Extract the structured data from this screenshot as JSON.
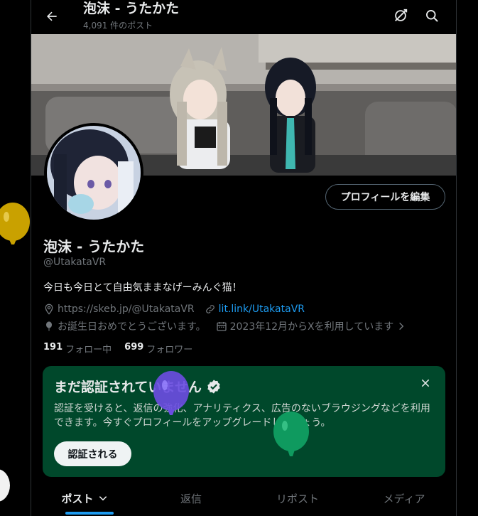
{
  "header": {
    "title": "泡沫 - うたかた",
    "post_count": "4,091 件のポスト"
  },
  "profile": {
    "name": "泡沫 - うたかた",
    "handle": "@UtakataVR",
    "bio": "今日も今日とて自由気ままなげーみんぐ猫！",
    "website": "https://skeb.jp/@UtakataVR",
    "link": "lit.link/UtakataVR",
    "birthday": "お誕生日おめでとうございます。",
    "joined": "2023年12月からXを利用しています",
    "following_count": "191",
    "following_label": "フォロー中",
    "followers_count": "699",
    "followers_label": "フォロワー",
    "edit_button": "プロフィールを編集"
  },
  "verify_card": {
    "title": "まだ認証されていません",
    "body": "認証を受けると、返信の強化、アナリティクス、広告のないブラウジングなどを利用できます。今すぐプロフィールをアップグレードしましょう。",
    "button": "認証される"
  },
  "tabs": [
    {
      "label": "ポスト"
    },
    {
      "label": "返信"
    },
    {
      "label": "リポスト"
    },
    {
      "label": "メディア"
    }
  ],
  "colors": {
    "background": "#000000",
    "accent": "#1d9bf0",
    "verify_card": "#00482b",
    "balloon_yellow": "#c9a100",
    "balloon_purple": "#6a4de0",
    "balloon_green": "#0f9a5f"
  },
  "icons": [
    "back-arrow-icon",
    "subscribe-icon",
    "search-icon",
    "location-icon",
    "link-icon",
    "balloon-icon",
    "calendar-icon",
    "chevron-right-icon",
    "verified-badge-icon",
    "close-icon",
    "chevron-down-icon"
  ]
}
